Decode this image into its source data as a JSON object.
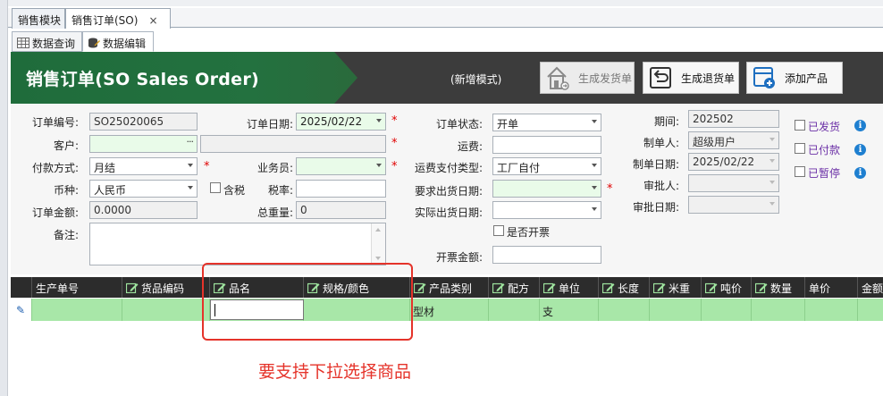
{
  "doc_tabs": [
    {
      "label": "销售模块",
      "active": false
    },
    {
      "label": "销售订单(SO)",
      "active": true
    }
  ],
  "doc_tab_close": "×",
  "sub_tabs": [
    {
      "label": "数据查询",
      "icon": "table-icon",
      "active": false
    },
    {
      "label": "数据编辑",
      "icon": "database-icon",
      "active": true
    }
  ],
  "banner": {
    "title": "销售订单(SO Sales Order)",
    "mode": "(新增模式)",
    "buttons": [
      {
        "label": "生成发货单",
        "icon": "house-icon",
        "disabled": true
      },
      {
        "label": "生成退货单",
        "icon": "return-icon",
        "disabled": false
      },
      {
        "label": "添加产品",
        "icon": "add-product-icon",
        "disabled": false
      }
    ]
  },
  "form": {
    "order_no": {
      "label": "订单编号:",
      "value": "SO25020065"
    },
    "order_date": {
      "label": "订单日期:",
      "value": "2025/02/22"
    },
    "order_status": {
      "label": "订单状态:",
      "value": "开单"
    },
    "period": {
      "label": "期间:",
      "value": "202502"
    },
    "customer": {
      "label": "客户:",
      "value": "",
      "button": "···"
    },
    "freight": {
      "label": "运费:",
      "value": ""
    },
    "creator": {
      "label": "制单人:",
      "value": "超级用户"
    },
    "payment": {
      "label": "付款方式:",
      "value": "月结"
    },
    "salesman": {
      "label": "业务员:",
      "value": ""
    },
    "freight_pay": {
      "label": "运费支付类型:",
      "value": "工厂自付"
    },
    "create_date": {
      "label": "制单日期:",
      "value": "2025/02/22"
    },
    "currency": {
      "label": "币种:",
      "value": "人民币"
    },
    "tax_included": {
      "label": "含税"
    },
    "tax_rate": {
      "label": "税率:",
      "value": ""
    },
    "req_ship_date": {
      "label": "要求出货日期:",
      "value": ""
    },
    "approver": {
      "label": "审批人:",
      "value": ""
    },
    "order_amount": {
      "label": "订单金额:",
      "value": "0.0000"
    },
    "total_weight": {
      "label": "总重量:",
      "value": "0"
    },
    "actual_ship_date": {
      "label": "实际出货日期:",
      "value": ""
    },
    "approve_date": {
      "label": "审批日期:",
      "value": ""
    },
    "remark": {
      "label": "备注:",
      "value": ""
    },
    "invoice_flag": {
      "label": "是否开票"
    },
    "invoice_amount": {
      "label": "开票金额:",
      "value": ""
    },
    "required_mark": "*",
    "status_checks": [
      {
        "label": "已发货"
      },
      {
        "label": "已付款"
      },
      {
        "label": "已暂停"
      }
    ],
    "info_glyph": "i"
  },
  "grid": {
    "columns": [
      {
        "label": "生产单号",
        "editable": false
      },
      {
        "label": "货品编码",
        "editable": true
      },
      {
        "label": "品名",
        "editable": true
      },
      {
        "label": "规格/颜色",
        "editable": true
      },
      {
        "label": "产品类别",
        "editable": true
      },
      {
        "label": "配方",
        "editable": true
      },
      {
        "label": "单位",
        "editable": true
      },
      {
        "label": "长度",
        "editable": true
      },
      {
        "label": "米重",
        "editable": true
      },
      {
        "label": "吨价",
        "editable": true
      },
      {
        "label": "数量",
        "editable": true
      },
      {
        "label": "单价",
        "editable": false
      },
      {
        "label": "金额",
        "editable": false
      }
    ],
    "rows": [
      {
        "cells": [
          "",
          "",
          "",
          "",
          "型材",
          "",
          "支",
          "",
          "",
          "",
          "",
          "",
          ""
        ]
      }
    ],
    "row_indicator": "✎"
  },
  "annotation": "要支持下拉选择商品",
  "colors": {
    "banner_green": "#23713f",
    "row_highlight": "#a8e7a8",
    "annotation_red": "#e5332a",
    "header_dark": "#2c2c2c"
  }
}
